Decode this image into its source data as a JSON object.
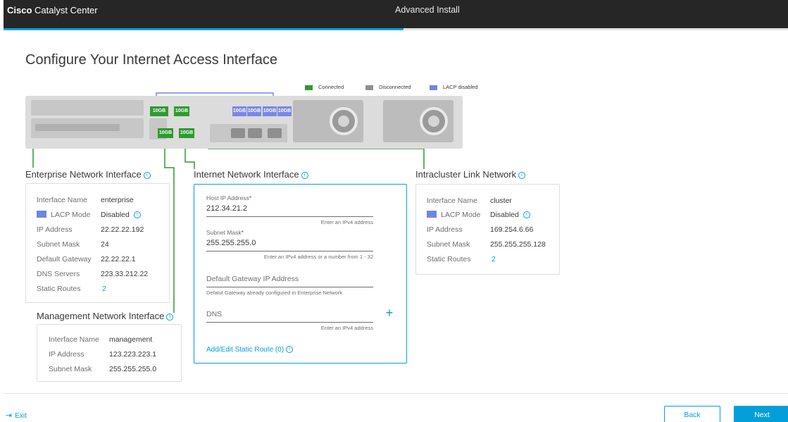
{
  "header": {
    "brand_bold": "Cisco",
    "brand_rest": " Catalyst Center",
    "center_title": "Advanced Install",
    "progress_fraction": 0.51
  },
  "page": {
    "title": "Configure Your Internet Access Interface"
  },
  "diagram": {
    "legend": [
      {
        "label": "Connected",
        "color": "#2e9b2e"
      },
      {
        "label": "Disconnected",
        "color": "#8e8e8e"
      },
      {
        "label": "LACP disabled",
        "color": "#6f86e1"
      }
    ],
    "port_label": "10GB",
    "colors": {
      "connected": "#2e9b2e",
      "lacp_disabled": "#7b87e6",
      "wire_blue": "#6f86e1"
    }
  },
  "enterprise": {
    "title": "Enterprise Network Interface",
    "info_icon": "info-icon",
    "rows": [
      {
        "key": "Interface Name",
        "value": "enterprise"
      },
      {
        "key": "LACP Mode",
        "value": "Disabled"
      },
      {
        "key": "IP Address",
        "value": "22.22.22.192"
      },
      {
        "key": "Subnet Mask",
        "value": "24"
      },
      {
        "key": "Default Gateway",
        "value": "22.22.22.1"
      },
      {
        "key": "DNS Servers",
        "value": "223.33.212.22"
      },
      {
        "key": "Static Routes",
        "value": "2"
      }
    ]
  },
  "management": {
    "title": "Management Network Interface",
    "rows": [
      {
        "key": "Interface Name",
        "value": "management"
      },
      {
        "key": "IP Address",
        "value": "123.223.223.1"
      },
      {
        "key": "Subnet Mask",
        "value": "255.255.255.0"
      }
    ]
  },
  "internet": {
    "title": "Internet Network Interface",
    "host_ip": {
      "label": "Host IP Address",
      "required": "*",
      "value": "212.34.21.2",
      "help": "Enter an IPv4 address"
    },
    "subnet": {
      "label": "Subnet Mask",
      "required": "*",
      "value": "255.255.255.0",
      "help": "Enter an IPv4 address or a number from 1 - 32"
    },
    "gateway": {
      "placeholder": "Default Gateway IP Address",
      "help": "Defalut Gateway already configured in Enterprise Network"
    },
    "dns": {
      "placeholder": "DNS",
      "help": "Enter an IPv4 address",
      "add_icon": "plus-icon"
    },
    "static_route_link": "Add/Edit Static Route (0)"
  },
  "intracluster": {
    "title": "Intracluster Link Network",
    "rows": [
      {
        "key": "Interface Name",
        "value": "cluster"
      },
      {
        "key": "LACP Mode",
        "value": "Disabled"
      },
      {
        "key": "IP Address",
        "value": "169.254.6.66"
      },
      {
        "key": "Subnet Mask",
        "value": "255.255.255.128"
      },
      {
        "key": "Static Routes",
        "value": "2"
      }
    ]
  },
  "footer": {
    "exit_label": "Exit",
    "exit_icon": "exit-icon",
    "back_label": "Back",
    "next_label": "Next"
  }
}
